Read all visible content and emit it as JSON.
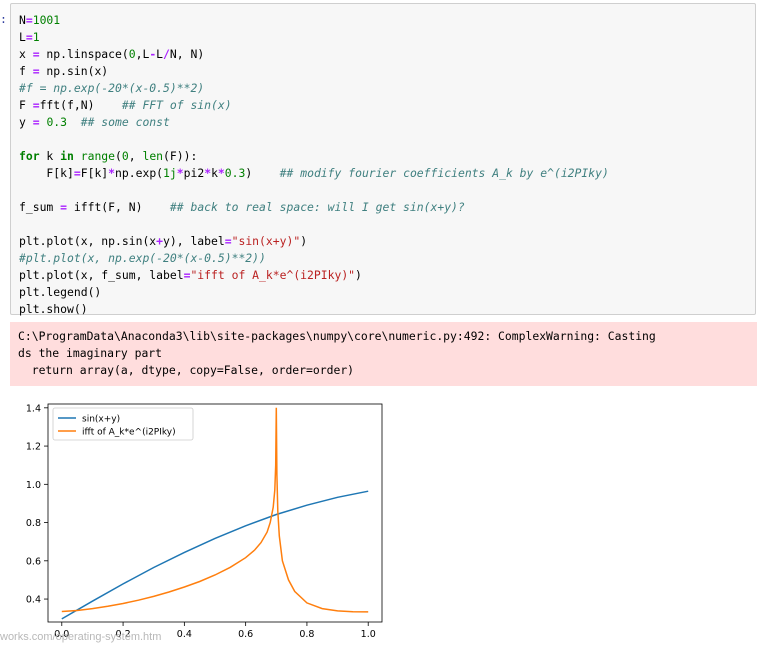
{
  "prompt": ":",
  "code_lines": [
    [
      {
        "t": "N"
      },
      {
        "t": "=",
        "c": "op"
      },
      {
        "t": "1001",
        "c": "num"
      }
    ],
    [
      {
        "t": "L"
      },
      {
        "t": "=",
        "c": "op"
      },
      {
        "t": "1",
        "c": "num"
      }
    ],
    [
      {
        "t": "x "
      },
      {
        "t": "=",
        "c": "op"
      },
      {
        "t": " np.linspace("
      },
      {
        "t": "0",
        "c": "num"
      },
      {
        "t": ",L"
      },
      {
        "t": "-",
        "c": "op"
      },
      {
        "t": "L"
      },
      {
        "t": "/",
        "c": "op"
      },
      {
        "t": "N, N)"
      }
    ],
    [
      {
        "t": "f "
      },
      {
        "t": "=",
        "c": "op"
      },
      {
        "t": " np.sin(x)"
      }
    ],
    [
      {
        "t": "#f = np.exp(-20*(x-0.5)**2)",
        "c": "cm"
      }
    ],
    [
      {
        "t": "F "
      },
      {
        "t": "=",
        "c": "op"
      },
      {
        "t": "fft(f,N)    "
      },
      {
        "t": "## FFT of sin(x)",
        "c": "cm"
      }
    ],
    [
      {
        "t": "y "
      },
      {
        "t": "=",
        "c": "op"
      },
      {
        "t": " "
      },
      {
        "t": "0.3",
        "c": "num"
      },
      {
        "t": "  "
      },
      {
        "t": "## some const",
        "c": "cm"
      }
    ],
    [],
    [
      {
        "t": "for",
        "c": "kw"
      },
      {
        "t": " k "
      },
      {
        "t": "in",
        "c": "kw"
      },
      {
        "t": " "
      },
      {
        "t": "range",
        "c": "num"
      },
      {
        "t": "("
      },
      {
        "t": "0",
        "c": "num"
      },
      {
        "t": ", "
      },
      {
        "t": "len",
        "c": "num"
      },
      {
        "t": "(F)):"
      }
    ],
    [
      {
        "t": "    F[k]"
      },
      {
        "t": "=",
        "c": "op"
      },
      {
        "t": "F[k]"
      },
      {
        "t": "*",
        "c": "op"
      },
      {
        "t": "np.exp("
      },
      {
        "t": "1j",
        "c": "num"
      },
      {
        "t": "*",
        "c": "op"
      },
      {
        "t": "pi2"
      },
      {
        "t": "*",
        "c": "op"
      },
      {
        "t": "k"
      },
      {
        "t": "*",
        "c": "op"
      },
      {
        "t": "0.3",
        "c": "num"
      },
      {
        "t": ")    "
      },
      {
        "t": "## modify fourier coefficients A_k by e^(i2PIky)",
        "c": "cm"
      }
    ],
    [],
    [
      {
        "t": "f_sum "
      },
      {
        "t": "=",
        "c": "op"
      },
      {
        "t": " ifft(F, N)    "
      },
      {
        "t": "## back to real space: will I get sin(x+y)?",
        "c": "cm"
      }
    ],
    [],
    [
      {
        "t": "plt.plot(x, np.sin(x"
      },
      {
        "t": "+",
        "c": "op"
      },
      {
        "t": "y), label"
      },
      {
        "t": "=",
        "c": "op"
      },
      {
        "t": "\"sin(x+y)\"",
        "c": "st"
      },
      {
        "t": ")"
      }
    ],
    [
      {
        "t": "#plt.plot(x, np.exp(-20*(x-0.5)**2))",
        "c": "cm"
      }
    ],
    [
      {
        "t": "plt.plot(x, f_sum, label"
      },
      {
        "t": "=",
        "c": "op"
      },
      {
        "t": "\"ifft of A_k*e^(i2PIky)\"",
        "c": "st"
      },
      {
        "t": ")"
      }
    ],
    [
      {
        "t": "plt.legend()"
      }
    ],
    [
      {
        "t": "plt.show()"
      }
    ]
  ],
  "stderr_lines": [
    "C:\\ProgramData\\Anaconda3\\lib\\site-packages\\numpy\\core\\numeric.py:492: ComplexWarning: Casting",
    "ds the imaginary part",
    "  return array(a, dtype, copy=False, order=order)"
  ],
  "chart_data": {
    "type": "line",
    "x_ticks": [
      "0.0",
      "0.2",
      "0.4",
      "0.6",
      "0.8",
      "1.0"
    ],
    "y_ticks": [
      "0.4",
      "0.6",
      "0.8",
      "1.0",
      "1.2",
      "1.4"
    ],
    "xlim": [
      -0.045,
      1.045
    ],
    "ylim": [
      0.28,
      1.42
    ],
    "legend_placement": "upper-left",
    "series": [
      {
        "name": "sin(x+y)",
        "color": "#1f77b4",
        "x": [
          0,
          0.1,
          0.2,
          0.3,
          0.4,
          0.5,
          0.6,
          0.7,
          0.8,
          0.9,
          1.0
        ],
        "y": [
          0.296,
          0.389,
          0.479,
          0.565,
          0.644,
          0.717,
          0.783,
          0.842,
          0.891,
          0.932,
          0.964
        ]
      },
      {
        "name": "ifft of A_k*e^(i2PIky)",
        "color": "#ff7f0e",
        "x": [
          0,
          0.05,
          0.1,
          0.15,
          0.2,
          0.25,
          0.3,
          0.35,
          0.4,
          0.45,
          0.5,
          0.55,
          0.6,
          0.63,
          0.65,
          0.67,
          0.68,
          0.69,
          0.695,
          0.698,
          0.7,
          0.702,
          0.705,
          0.71,
          0.72,
          0.74,
          0.76,
          0.8,
          0.85,
          0.9,
          0.95,
          1.0
        ],
        "y": [
          0.335,
          0.34,
          0.35,
          0.362,
          0.377,
          0.394,
          0.414,
          0.437,
          0.463,
          0.492,
          0.526,
          0.566,
          0.616,
          0.657,
          0.695,
          0.75,
          0.8,
          0.88,
          0.97,
          1.1,
          1.4,
          1.05,
          0.86,
          0.73,
          0.6,
          0.5,
          0.44,
          0.38,
          0.35,
          0.338,
          0.334,
          0.333
        ]
      }
    ]
  },
  "watermark": "works.com/operating-system.htm"
}
